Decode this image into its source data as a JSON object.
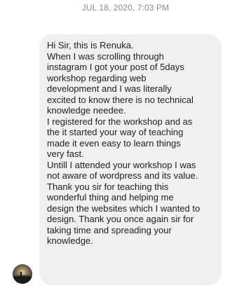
{
  "conversation": {
    "timestamp": "JUL 18, 2020, 7:03 PM"
  },
  "message": {
    "lines": [
      "Hi Sir, this is Renuka.",
      "When I was scrolling through",
      "instagram I got your post of 5days",
      "workshop regarding web",
      "development and I was literally",
      "excited to know there is no technical",
      "knowledge needee.",
      "I registered for the workshop and as",
      "the it started your way of teaching",
      "made it even easy to learn things",
      "very fast.",
      "Untill I attended your workshop I was",
      "not aware of wordpress and its value.",
      "Thank you sir for teaching this",
      "wonderful thing and helping me",
      "design the websites which I wanted to",
      "design. Thank you once again sir for",
      "taking time and spreading your",
      "knowledge."
    ]
  },
  "sender": {
    "avatar_icon": "profile-photo-sunset"
  },
  "colors": {
    "bubble_bg": "#f0f0f0",
    "text": "#1c1e21",
    "timestamp": "#8a8d91"
  }
}
